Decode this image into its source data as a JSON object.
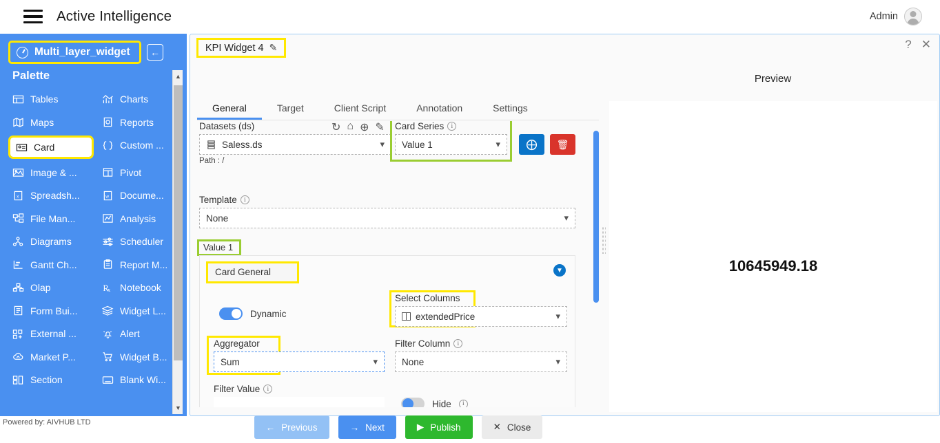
{
  "topbar": {
    "menu_icon": "hamburger-icon",
    "title": "Active Intelligence",
    "admin_label": "Admin",
    "avatar_icon": "user-avatar-icon"
  },
  "sidebar": {
    "widget_name": "Multi_layer_widget",
    "widget_icon": "gauge-icon",
    "collapse_icon": "←",
    "palette_title": "Palette",
    "items": [
      {
        "label": "Tables",
        "icon": "table-icon"
      },
      {
        "label": "Charts",
        "icon": "chart-icon"
      },
      {
        "label": "Maps",
        "icon": "map-icon"
      },
      {
        "label": "Reports",
        "icon": "report-icon"
      },
      {
        "label": "Card",
        "icon": "card-icon",
        "selected": true
      },
      {
        "label": "Custom ...",
        "icon": "braces-icon"
      },
      {
        "label": "Image & ...",
        "icon": "image-icon"
      },
      {
        "label": "Pivot",
        "icon": "pivot-icon"
      },
      {
        "label": "Spreadsh...",
        "icon": "spreadsheet-icon"
      },
      {
        "label": "Docume...",
        "icon": "word-document-icon"
      },
      {
        "label": "File Man...",
        "icon": "file-manager-icon"
      },
      {
        "label": "Analysis",
        "icon": "analysis-icon"
      },
      {
        "label": "Diagrams",
        "icon": "diagram-icon"
      },
      {
        "label": "Scheduler",
        "icon": "scheduler-icon"
      },
      {
        "label": "Gantt Ch...",
        "icon": "gantt-icon"
      },
      {
        "label": "Report M...",
        "icon": "report-manager-icon"
      },
      {
        "label": "Olap",
        "icon": "olap-icon"
      },
      {
        "label": "Notebook",
        "icon": "notebook-icon"
      },
      {
        "label": "Form Bui...",
        "icon": "form-builder-icon"
      },
      {
        "label": "Widget L...",
        "icon": "layers-icon"
      },
      {
        "label": "External ...",
        "icon": "external-icon"
      },
      {
        "label": "Alert",
        "icon": "bell-icon"
      },
      {
        "label": "Market P...",
        "icon": "cloud-icon"
      },
      {
        "label": "Widget B...",
        "icon": "cart-icon"
      },
      {
        "label": "Section",
        "icon": "section-icon"
      },
      {
        "label": "Blank Wi...",
        "icon": "blank-window-icon"
      }
    ]
  },
  "footer": {
    "text": "Powered by: AIVHUB LTD"
  },
  "dialog": {
    "title": "KPI Widget 4",
    "title_edit_icon": "pencil-edit-icon",
    "help_icon": "?",
    "close_icon": "✕",
    "tabs": [
      {
        "label": "General",
        "active": true
      },
      {
        "label": "Target",
        "active": false
      },
      {
        "label": "Client Script",
        "active": false
      },
      {
        "label": "Annotation",
        "active": false
      },
      {
        "label": "Settings",
        "active": false
      }
    ],
    "datasets": {
      "label": "Datasets (ds)",
      "value": "Saless.ds",
      "file_icon": "dataset-icon",
      "path_text": "Path : /",
      "icons": [
        {
          "name": "refresh-icon",
          "glyph": "↻"
        },
        {
          "name": "home-icon",
          "glyph": "⌂"
        },
        {
          "name": "add-circle-icon",
          "glyph": "⊕"
        },
        {
          "name": "edit-icon",
          "glyph": "✎"
        }
      ]
    },
    "card_series": {
      "label": "Card Series",
      "value": "Value 1",
      "add_button_icon": "add-circle-icon",
      "delete_button_icon": "trash-icon"
    },
    "template": {
      "label": "Template",
      "value": "None"
    },
    "value_section_label": "Value 1",
    "card_general": {
      "header": "Card General",
      "collapse_icon": "chevron-down-icon",
      "dynamic": {
        "label": "Dynamic",
        "state": "on"
      },
      "select_columns": {
        "label": "Select Columns",
        "value": "extendedPrice",
        "column_icon": "column-icon"
      },
      "aggregator": {
        "label": "Aggregator",
        "value": "Sum"
      },
      "filter_column": {
        "label": "Filter Column",
        "value": "None"
      },
      "filter_value": {
        "label": "Filter Value",
        "value": "",
        "placeholder": ""
      },
      "hide": {
        "label": "Hide",
        "state": "off"
      }
    },
    "actions": [
      {
        "label": "Previous",
        "icon": "arrow-left-icon",
        "glyph": "←",
        "key": "prev"
      },
      {
        "label": "Next",
        "icon": "arrow-right-icon",
        "glyph": "→",
        "key": "next"
      },
      {
        "label": "Publish",
        "icon": "play-icon",
        "glyph": "▶",
        "key": "pub"
      },
      {
        "label": "Close",
        "icon": "close-icon",
        "glyph": "✕",
        "key": "close"
      }
    ],
    "preview": {
      "title": "Preview",
      "value": "10645949.18"
    }
  },
  "colors": {
    "brand_blue": "#4a90f0",
    "highlight_yellow": "#ffe800",
    "highlight_green": "#9acd32",
    "publish_green": "#2eb82e",
    "delete_red": "#d9342b"
  }
}
